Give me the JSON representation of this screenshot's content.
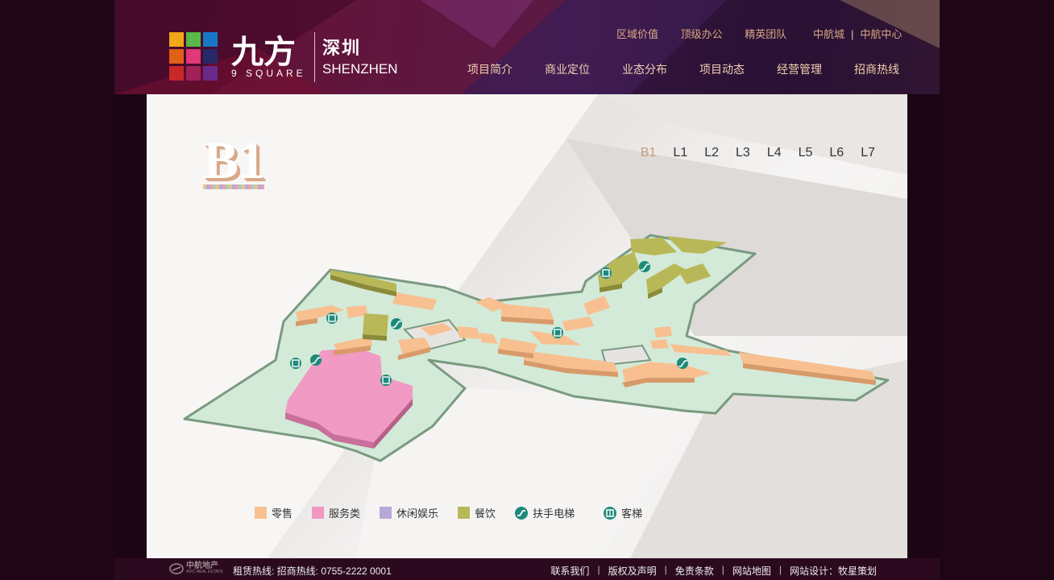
{
  "header": {
    "brand_cn": "九方",
    "brand_en": "9 SQUARE",
    "city_cn": "深圳",
    "city_en": "SHENZHEN",
    "util_links": [
      "区域价值",
      "顶级办公",
      "精英团队"
    ],
    "group_links": [
      "中航城",
      "中航中心"
    ],
    "nav": [
      "项目简介",
      "商业定位",
      "业态分布",
      "项目动态",
      "经营管理",
      "招商热线"
    ],
    "logo_colors": [
      "#f0a818",
      "#58b848",
      "#1878c8",
      "#e06018",
      "#e03878",
      "#282868",
      "#c82828",
      "#a02058",
      "#6a2a8a"
    ]
  },
  "floor": {
    "current_badge": "B1",
    "tabs": [
      "B1",
      "L1",
      "L2",
      "L3",
      "L4",
      "L5",
      "L6",
      "L7"
    ],
    "active": "B1"
  },
  "legend": {
    "retail": {
      "label": "零售",
      "color": "#f8c090"
    },
    "service": {
      "label": "服务类",
      "color": "#f098c0"
    },
    "leisure": {
      "label": "休闲娱乐",
      "color": "#b8a8d8"
    },
    "dining": {
      "label": "餐饮",
      "color": "#b8b858"
    },
    "escalator": {
      "label": "扶手电梯",
      "icon": "escalator-icon"
    },
    "elevator": {
      "label": "客梯",
      "icon": "elevator-icon"
    }
  },
  "footer": {
    "company_logo": "中航地产",
    "company_logo_sub": "AVIC REAL ESTATE",
    "hotline": "租赁热线: 招商热线: 0755-2222 0001",
    "links": [
      "联系我们",
      "版权及声明",
      "免责条款",
      "网站地图",
      "网站设计：牧星策划"
    ]
  }
}
